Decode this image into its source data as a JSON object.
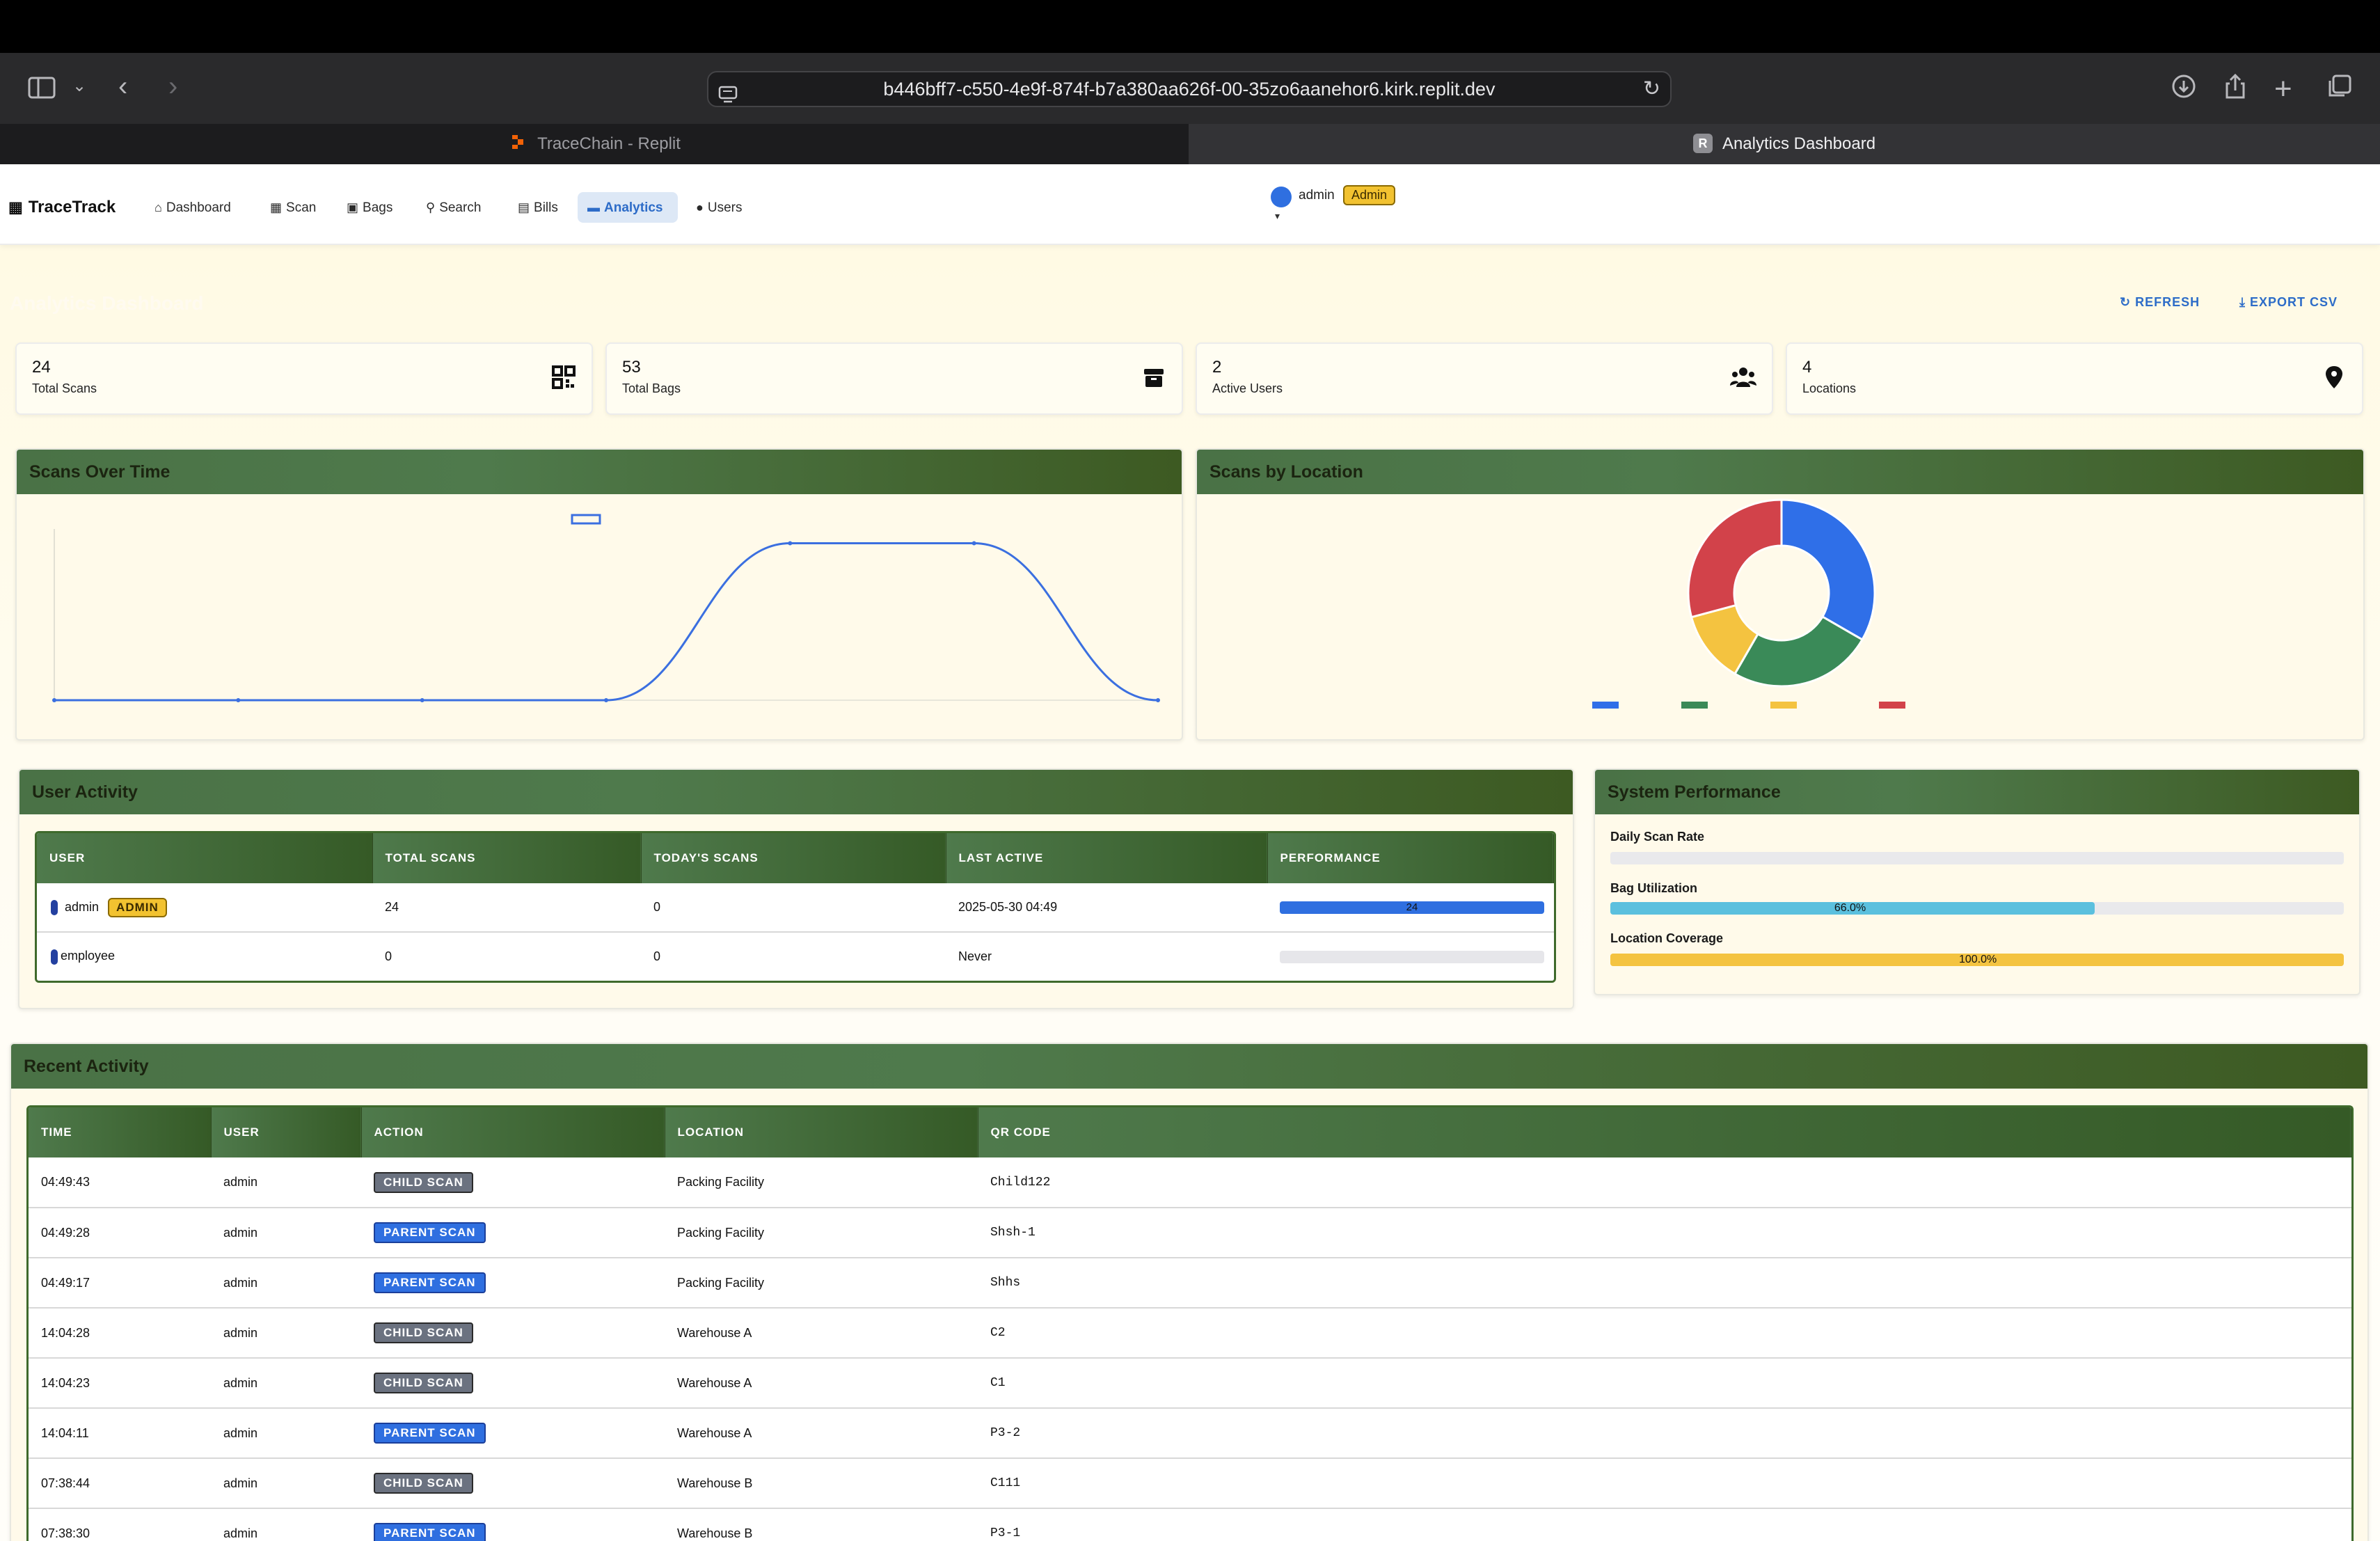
{
  "browser": {
    "url": "b446bff7-c550-4e9f-874f-b7a380aa626f-00-35zo6aanehor6.kirk.replit.dev",
    "tabs": [
      {
        "label": "TraceChain - Replit",
        "active": false
      },
      {
        "label": "Analytics Dashboard",
        "active": true,
        "favicon": "R"
      }
    ]
  },
  "nav": {
    "brand": "TraceTrack",
    "links": [
      {
        "label": "Dashboard",
        "icon": "home-icon"
      },
      {
        "label": "Scan",
        "icon": "qr-icon"
      },
      {
        "label": "Bags",
        "icon": "boxes-icon"
      },
      {
        "label": "Search",
        "icon": "search-icon"
      },
      {
        "label": "Bills",
        "icon": "file-icon"
      },
      {
        "label": "Analytics",
        "icon": "chart-icon",
        "active": true
      },
      {
        "label": "Users",
        "icon": "users-icon"
      }
    ],
    "user": {
      "name": "admin",
      "role_badge": "Admin"
    }
  },
  "page": {
    "title": "Analytics Dashboard",
    "actions": {
      "refresh": "REFRESH",
      "export": "EXPORT CSV"
    }
  },
  "stats": [
    {
      "value": "24",
      "label": "Total Scans",
      "icon": "qrcode-icon"
    },
    {
      "value": "53",
      "label": "Total Bags",
      "icon": "box-icon"
    },
    {
      "value": "2",
      "label": "Active Users",
      "icon": "users-icon"
    },
    {
      "value": "4",
      "label": "Locations",
      "icon": "map-pin-icon"
    }
  ],
  "charts": {
    "scans_over_time_title": "Scans Over Time",
    "scans_by_location_title": "Scans by Location"
  },
  "chart_data": [
    {
      "type": "line",
      "x": [
        "",
        "",
        "",
        "",
        "",
        "",
        ""
      ],
      "series": [
        {
          "values": [
            0,
            0,
            0,
            0,
            11,
            11,
            0
          ],
          "color": "#3b6fe0"
        }
      ],
      "ylim": [
        0,
        12
      ],
      "grid": false,
      "legend": "top-center"
    },
    {
      "type": "pie",
      "donut": true,
      "values": [
        8,
        6,
        3,
        7
      ],
      "colors": [
        "#2f6fe8",
        "#3a8a58",
        "#f4c340",
        "#d2424a"
      ],
      "legend": "bottom"
    }
  ],
  "user_activity": {
    "title": "User Activity",
    "columns": [
      "USER",
      "TOTAL SCANS",
      "TODAY'S SCANS",
      "LAST ACTIVE",
      "PERFORMANCE"
    ],
    "rows": [
      {
        "user": "admin",
        "badge": "ADMIN",
        "total": "24",
        "today": "0",
        "last_active": "2025-05-30 04:49",
        "performance": 1.0,
        "performance_label": "24"
      },
      {
        "user": "employee",
        "badge": "",
        "total": "0",
        "today": "0",
        "last_active": "Never",
        "performance": 0.0,
        "performance_label": ""
      }
    ]
  },
  "system_performance": {
    "title": "System Performance",
    "metrics": [
      {
        "label": "Daily Scan Rate",
        "value": 0.0,
        "text": "",
        "color": "#5bc0de"
      },
      {
        "label": "Bag Utilization",
        "value": 0.66,
        "text": "66.0%",
        "color": "#5bc0de"
      },
      {
        "label": "Location Coverage",
        "value": 1.0,
        "text": "100.0%",
        "color": "#f4c340"
      }
    ]
  },
  "recent_activity": {
    "title": "Recent Activity",
    "columns": [
      "TIME",
      "USER",
      "ACTION",
      "LOCATION",
      "QR CODE"
    ],
    "rows": [
      {
        "time": "04:49:43",
        "user": "admin",
        "action": "CHILD SCAN",
        "kind": "child",
        "location": "Packing Facility",
        "qr": "Child122"
      },
      {
        "time": "04:49:28",
        "user": "admin",
        "action": "PARENT SCAN",
        "kind": "parent",
        "location": "Packing Facility",
        "qr": "Shsh-1"
      },
      {
        "time": "04:49:17",
        "user": "admin",
        "action": "PARENT SCAN",
        "kind": "parent",
        "location": "Packing Facility",
        "qr": "Shhs"
      },
      {
        "time": "14:04:28",
        "user": "admin",
        "action": "CHILD SCAN",
        "kind": "child",
        "location": "Warehouse A",
        "qr": "C2"
      },
      {
        "time": "14:04:23",
        "user": "admin",
        "action": "CHILD SCAN",
        "kind": "child",
        "location": "Warehouse A",
        "qr": "C1"
      },
      {
        "time": "14:04:11",
        "user": "admin",
        "action": "PARENT SCAN",
        "kind": "parent",
        "location": "Warehouse A",
        "qr": "P3-2"
      },
      {
        "time": "07:38:44",
        "user": "admin",
        "action": "CHILD SCAN",
        "kind": "child",
        "location": "Warehouse B",
        "qr": "C111"
      },
      {
        "time": "07:38:30",
        "user": "admin",
        "action": "PARENT SCAN",
        "kind": "parent",
        "location": "Warehouse B",
        "qr": "P3-1"
      }
    ]
  }
}
